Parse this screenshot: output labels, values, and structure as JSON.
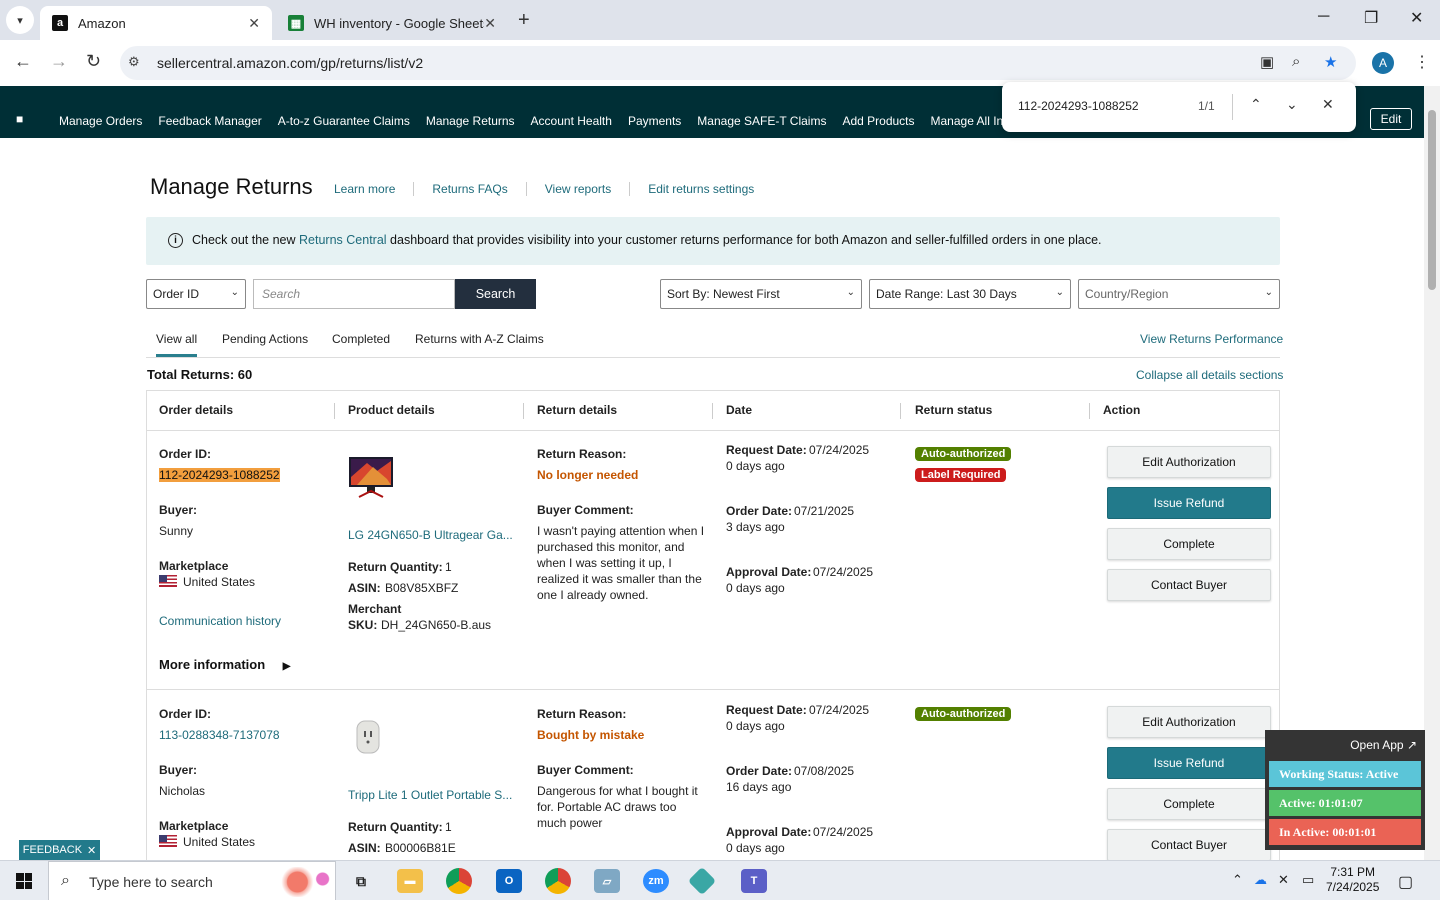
{
  "browser": {
    "tabs": [
      {
        "title": "Amazon",
        "favicon": "a"
      },
      {
        "title": "WH inventory - Google Sheets",
        "favicon": "sheets"
      }
    ],
    "url": "sellercentral.amazon.com/gp/returns/list/v2",
    "profile_initial": "A",
    "find": {
      "query": "112-2024293-1088252",
      "count": "1/1"
    }
  },
  "nav": {
    "items": [
      "Manage Orders",
      "Feedback Manager",
      "A-to-z Guarantee Claims",
      "Manage Returns",
      "Account Health",
      "Payments",
      "Manage SAFE-T Claims",
      "Add Products",
      "Manage All Inven"
    ],
    "edit_label": "Edit"
  },
  "page": {
    "title": "Manage Returns",
    "links": [
      "Learn more",
      "Returns FAQs",
      "View reports",
      "Edit returns settings"
    ],
    "banner": {
      "prefix": "Check out the new ",
      "link": "Returns Central",
      "suffix": " dashboard that provides visibility into your customer returns performance for both Amazon and seller-fulfilled orders in one place."
    },
    "filters": {
      "search_type": "Order ID",
      "search_placeholder": "Search",
      "search_button": "Search",
      "sort": "Sort By: Newest First",
      "date_range": "Date Range: Last 30 Days",
      "country": "Country/Region"
    },
    "tabs": [
      "View all",
      "Pending Actions",
      "Completed",
      "Returns with A-Z Claims"
    ],
    "view_performance": "View Returns Performance",
    "total_returns": "Total Returns: 60",
    "collapse_all": "Collapse all details sections",
    "columns": [
      "Order details",
      "Product details",
      "Return details",
      "Date",
      "Return status",
      "Action"
    ]
  },
  "labels": {
    "order_id": "Order ID:",
    "buyer": "Buyer:",
    "marketplace": "Marketplace",
    "return_reason": "Return Reason:",
    "buyer_comment": "Buyer Comment:",
    "request_date": "Request Date:",
    "order_date": "Order Date:",
    "approval_date": "Approval Date:",
    "return_quantity": "Return Quantity:",
    "asin": "ASIN:",
    "merchant": "Merchant",
    "sku": "SKU:",
    "communication_history": "Communication history",
    "more_information": "More information"
  },
  "actions": [
    "Edit Authorization",
    "Issue Refund",
    "Complete",
    "Contact Buyer"
  ],
  "returns": [
    {
      "order_id": "112-2024293-1088252",
      "buyer": "Sunny",
      "marketplace": "United States",
      "product": "LG 24GN650-B Ultragear Ga...",
      "quantity": "1",
      "asin": "B08V85XBFZ",
      "sku": "DH_24GN650-B.aus",
      "reason": "No longer needed",
      "comment": "I wasn't paying attention when I purchased this monitor, and when I was setting it up, I realized it was smaller than the one I already owned.",
      "request_date": "07/24/2025",
      "request_ago": "0 days ago",
      "order_date": "07/21/2025",
      "order_ago": "3 days ago",
      "approval_date": "07/24/2025",
      "approval_ago": "0 days ago",
      "statuses": [
        "Auto-authorized",
        "Label Required"
      ]
    },
    {
      "order_id": "113-0288348-7137078",
      "buyer": "Nicholas",
      "marketplace": "United States",
      "product": "Tripp Lite 1 Outlet Portable S...",
      "quantity": "1",
      "asin": "B00006B81E",
      "reason": "Bought by mistake",
      "comment": "Dangerous for what I bought it for. Portable AC draws too much power",
      "request_date": "07/24/2025",
      "request_ago": "0 days ago",
      "order_date": "07/08/2025",
      "order_ago": "16 days ago",
      "approval_date": "07/24/2025",
      "approval_ago": "0 days ago",
      "statuses": [
        "Auto-authorized"
      ]
    }
  ],
  "widgets": {
    "feedback": "FEEDBACK",
    "tracker": {
      "open": "Open App",
      "status": "Working Status: Active",
      "active": "Active: 01:01:07",
      "inactive": "In Active: 00:01:01"
    }
  },
  "taskbar": {
    "search_placeholder": "Type here to search",
    "time": "7:31 PM",
    "date": "7/24/2025"
  },
  "colors": {
    "nav_bg": "#002f36",
    "primary_button": "#227a8b",
    "link": "#1e6b7b",
    "reason": "#c45500",
    "highlight": "#f29e3d"
  }
}
